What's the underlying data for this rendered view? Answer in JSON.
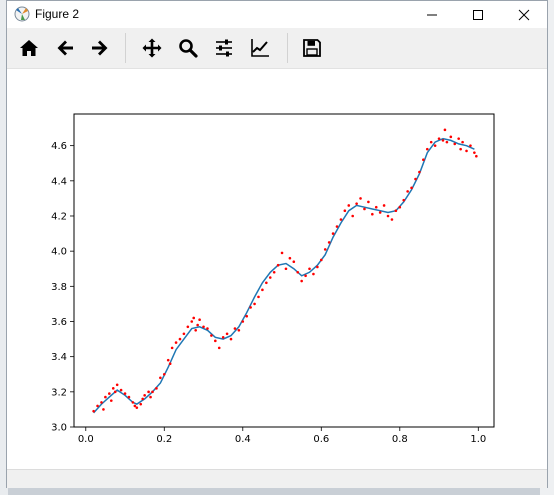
{
  "window": {
    "title": "Figure 2",
    "controls": {
      "minimize": "minimize-icon",
      "maximize": "maximize-icon",
      "close": "close-icon"
    }
  },
  "toolbar": {
    "buttons": [
      {
        "name": "home",
        "icon": "home-icon"
      },
      {
        "name": "back",
        "icon": "arrow-left-icon"
      },
      {
        "name": "forward",
        "icon": "arrow-right-icon"
      },
      {
        "name": "pan",
        "icon": "move-icon"
      },
      {
        "name": "zoom",
        "icon": "magnifier-icon"
      },
      {
        "name": "configure-subplots",
        "icon": "sliders-icon"
      },
      {
        "name": "edit-axis",
        "icon": "line-chart-icon"
      },
      {
        "name": "save",
        "icon": "floppy-disk-icon"
      }
    ]
  },
  "colors": {
    "points": "#ff0000",
    "fit_line": "#1f77b4",
    "axes": "#000000"
  },
  "chart_data": {
    "type": "scatter",
    "title": "",
    "xlabel": "",
    "ylabel": "",
    "xlim": [
      -0.03,
      1.04
    ],
    "ylim": [
      3.0,
      4.78
    ],
    "xticks": [
      "0.0",
      "0.2",
      "0.4",
      "0.6",
      "0.8",
      "1.0"
    ],
    "yticks": [
      "3.0",
      "3.2",
      "3.4",
      "3.6",
      "3.8",
      "4.0",
      "4.2",
      "4.4",
      "4.6"
    ],
    "grid": false,
    "series": [
      {
        "kind": "scatter",
        "x": [
          0.02,
          0.03,
          0.04,
          0.045,
          0.05,
          0.06,
          0.065,
          0.07,
          0.075,
          0.08,
          0.09,
          0.1,
          0.11,
          0.12,
          0.125,
          0.13,
          0.14,
          0.145,
          0.15,
          0.16,
          0.165,
          0.17,
          0.18,
          0.19,
          0.2,
          0.21,
          0.215,
          0.22,
          0.23,
          0.24,
          0.25,
          0.26,
          0.27,
          0.275,
          0.28,
          0.285,
          0.29,
          0.3,
          0.31,
          0.32,
          0.33,
          0.34,
          0.35,
          0.36,
          0.37,
          0.38,
          0.39,
          0.4,
          0.41,
          0.42,
          0.43,
          0.44,
          0.45,
          0.46,
          0.47,
          0.48,
          0.49,
          0.5,
          0.51,
          0.52,
          0.53,
          0.54,
          0.55,
          0.56,
          0.57,
          0.58,
          0.59,
          0.6,
          0.61,
          0.62,
          0.63,
          0.64,
          0.65,
          0.66,
          0.67,
          0.68,
          0.69,
          0.7,
          0.71,
          0.72,
          0.73,
          0.74,
          0.75,
          0.76,
          0.77,
          0.78,
          0.79,
          0.8,
          0.81,
          0.82,
          0.83,
          0.84,
          0.85,
          0.86,
          0.87,
          0.88,
          0.89,
          0.9,
          0.91,
          0.915,
          0.92,
          0.93,
          0.94,
          0.95,
          0.955,
          0.96,
          0.97,
          0.98,
          0.99,
          0.995
        ],
        "y": [
          3.09,
          3.12,
          3.14,
          3.1,
          3.17,
          3.19,
          3.15,
          3.22,
          3.2,
          3.24,
          3.21,
          3.19,
          3.17,
          3.14,
          3.12,
          3.11,
          3.13,
          3.16,
          3.18,
          3.2,
          3.17,
          3.2,
          3.22,
          3.28,
          3.3,
          3.38,
          3.36,
          3.45,
          3.48,
          3.5,
          3.53,
          3.57,
          3.6,
          3.62,
          3.55,
          3.58,
          3.61,
          3.57,
          3.56,
          3.52,
          3.49,
          3.45,
          3.51,
          3.53,
          3.5,
          3.56,
          3.55,
          3.6,
          3.63,
          3.68,
          3.7,
          3.74,
          3.78,
          3.82,
          3.85,
          3.88,
          3.92,
          3.99,
          3.9,
          3.96,
          3.94,
          3.88,
          3.83,
          3.86,
          3.9,
          3.87,
          3.91,
          3.95,
          4.01,
          4.05,
          4.1,
          4.14,
          4.18,
          4.23,
          4.26,
          4.2,
          4.27,
          4.3,
          4.24,
          4.28,
          4.21,
          4.25,
          4.22,
          4.26,
          4.2,
          4.18,
          4.23,
          4.25,
          4.29,
          4.34,
          4.36,
          4.41,
          4.45,
          4.52,
          4.58,
          4.62,
          4.6,
          4.64,
          4.63,
          4.69,
          4.62,
          4.65,
          4.61,
          4.64,
          4.58,
          4.62,
          4.57,
          4.6,
          4.56,
          4.54
        ]
      },
      {
        "kind": "line",
        "x": [
          0.02,
          0.04,
          0.06,
          0.08,
          0.1,
          0.12,
          0.13,
          0.15,
          0.17,
          0.19,
          0.21,
          0.23,
          0.25,
          0.27,
          0.29,
          0.31,
          0.33,
          0.35,
          0.37,
          0.39,
          0.41,
          0.43,
          0.45,
          0.47,
          0.49,
          0.51,
          0.53,
          0.55,
          0.57,
          0.59,
          0.61,
          0.63,
          0.65,
          0.67,
          0.69,
          0.71,
          0.73,
          0.75,
          0.77,
          0.79,
          0.81,
          0.83,
          0.85,
          0.87,
          0.89,
          0.91,
          0.93,
          0.95,
          0.97,
          0.99
        ],
        "y": [
          3.08,
          3.13,
          3.17,
          3.21,
          3.18,
          3.14,
          3.13,
          3.16,
          3.2,
          3.25,
          3.34,
          3.44,
          3.5,
          3.56,
          3.57,
          3.55,
          3.51,
          3.5,
          3.52,
          3.57,
          3.65,
          3.74,
          3.82,
          3.88,
          3.92,
          3.93,
          3.9,
          3.86,
          3.88,
          3.92,
          3.98,
          4.08,
          4.16,
          4.23,
          4.26,
          4.25,
          4.24,
          4.23,
          4.22,
          4.23,
          4.28,
          4.35,
          4.44,
          4.56,
          4.62,
          4.64,
          4.63,
          4.61,
          4.6,
          4.58
        ]
      }
    ]
  }
}
